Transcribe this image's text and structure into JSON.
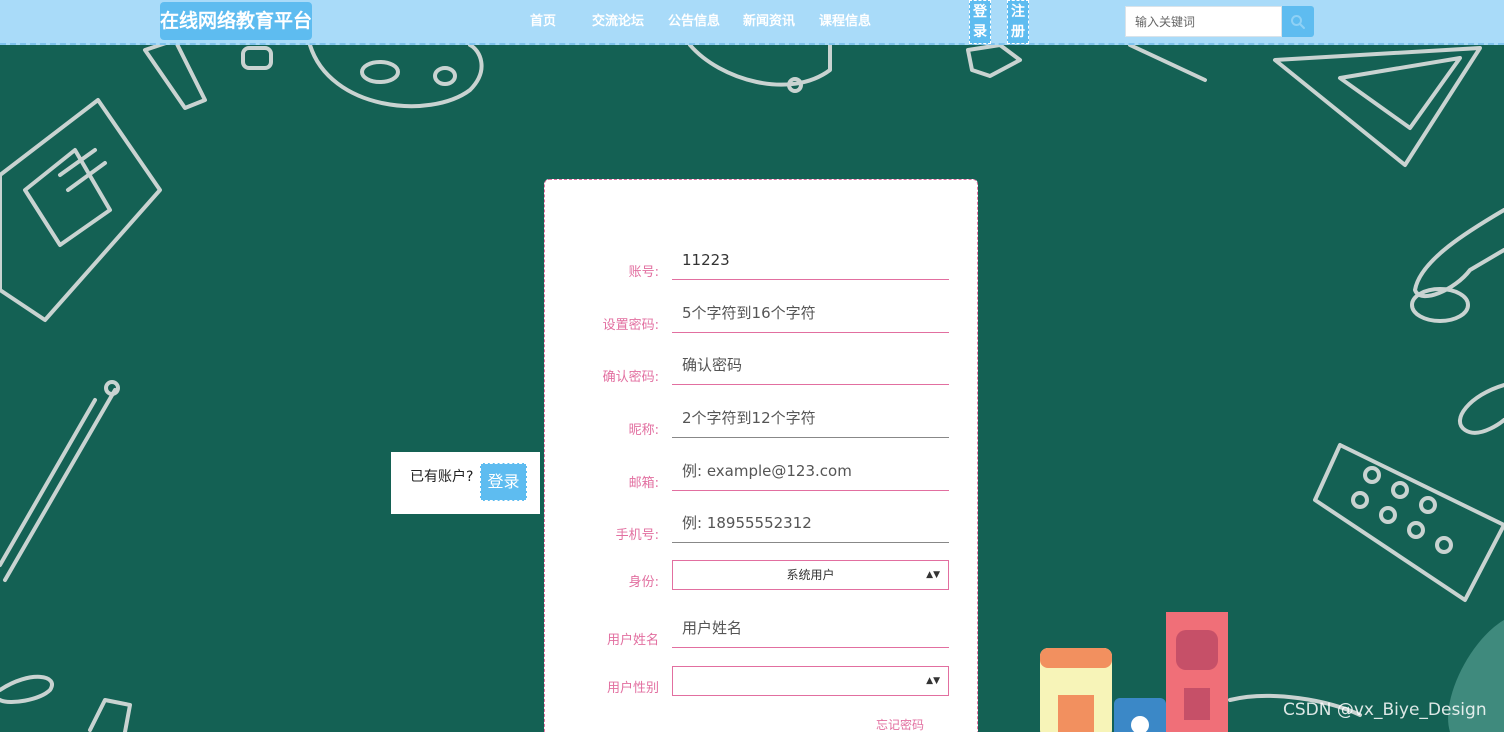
{
  "header": {
    "brand": "在线网络教育平台",
    "nav": [
      "首页",
      "交流论坛",
      "公告信息",
      "新闻资讯",
      "课程信息"
    ],
    "login_label": [
      "登",
      "录"
    ],
    "register_label": [
      "注",
      "册"
    ],
    "search_placeholder": "输入关键词"
  },
  "login_hint": {
    "text": "已有账户?",
    "button": "登录"
  },
  "form": {
    "fields": [
      {
        "label": "账号:",
        "value": "11223",
        "placeholder": ""
      },
      {
        "label": "设置密码:",
        "value": "",
        "placeholder": "5个字符到16个字符"
      },
      {
        "label": "确认密码:",
        "value": "",
        "placeholder": "确认密码"
      },
      {
        "label": "昵称:",
        "value": "",
        "placeholder": "2个字符到12个字符"
      },
      {
        "label": "邮箱:",
        "value": "",
        "placeholder": "例: example@123.com"
      },
      {
        "label": "手机号:",
        "value": "",
        "placeholder": "例: 18955552312"
      }
    ],
    "identity": {
      "label": "身份:",
      "selected": "系统用户"
    },
    "real_name": {
      "label": "用户姓名",
      "placeholder": "用户姓名"
    },
    "gender": {
      "label": "用户性别",
      "selected": ""
    },
    "forgot": "忘记密码"
  },
  "watermark": "CSDN @vx_Biye_Design"
}
